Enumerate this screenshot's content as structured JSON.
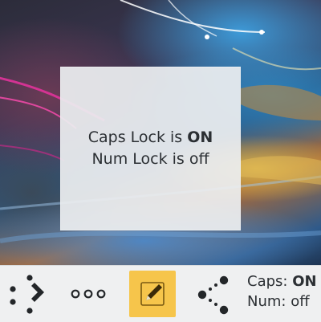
{
  "osd": {
    "caps_prefix": "Caps Lock is ",
    "caps_state": "ON",
    "num_prefix": "Num Lock is ",
    "num_state": "off"
  },
  "panel": {
    "items": [
      {
        "name": "kdeconnect",
        "icon": "kdeconnect-icon"
      },
      {
        "name": "overflow",
        "icon": "more-icon"
      },
      {
        "name": "knotes",
        "icon": "note-pencil-icon",
        "color": "#f6c54b"
      },
      {
        "name": "share",
        "icon": "share-icon"
      }
    ],
    "status": {
      "caps_label": "Caps: ",
      "caps_value": "ON",
      "num_label": "Num: ",
      "num_value": "off"
    }
  },
  "colors": {
    "panel_bg": "#eff0f1",
    "osd_bg": "#eceef0",
    "text": "#2b2f33",
    "note_tile": "#f6c54b"
  }
}
